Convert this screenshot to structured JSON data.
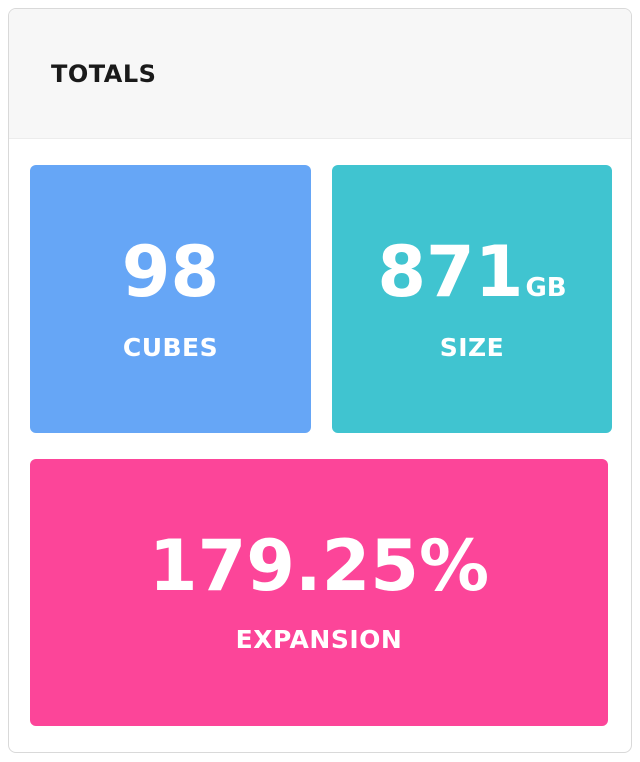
{
  "panel": {
    "title": "TOTALS"
  },
  "tiles": {
    "cubes": {
      "value": "98",
      "unit": "",
      "label": "CUBES",
      "color": "#66a6f6"
    },
    "size": {
      "value": "871",
      "unit": "GB",
      "label": "SIZE",
      "color": "#40c4d0"
    },
    "expansion": {
      "value": "179.25%",
      "unit": "",
      "label": "EXPANSION",
      "color": "#fc4599"
    }
  }
}
